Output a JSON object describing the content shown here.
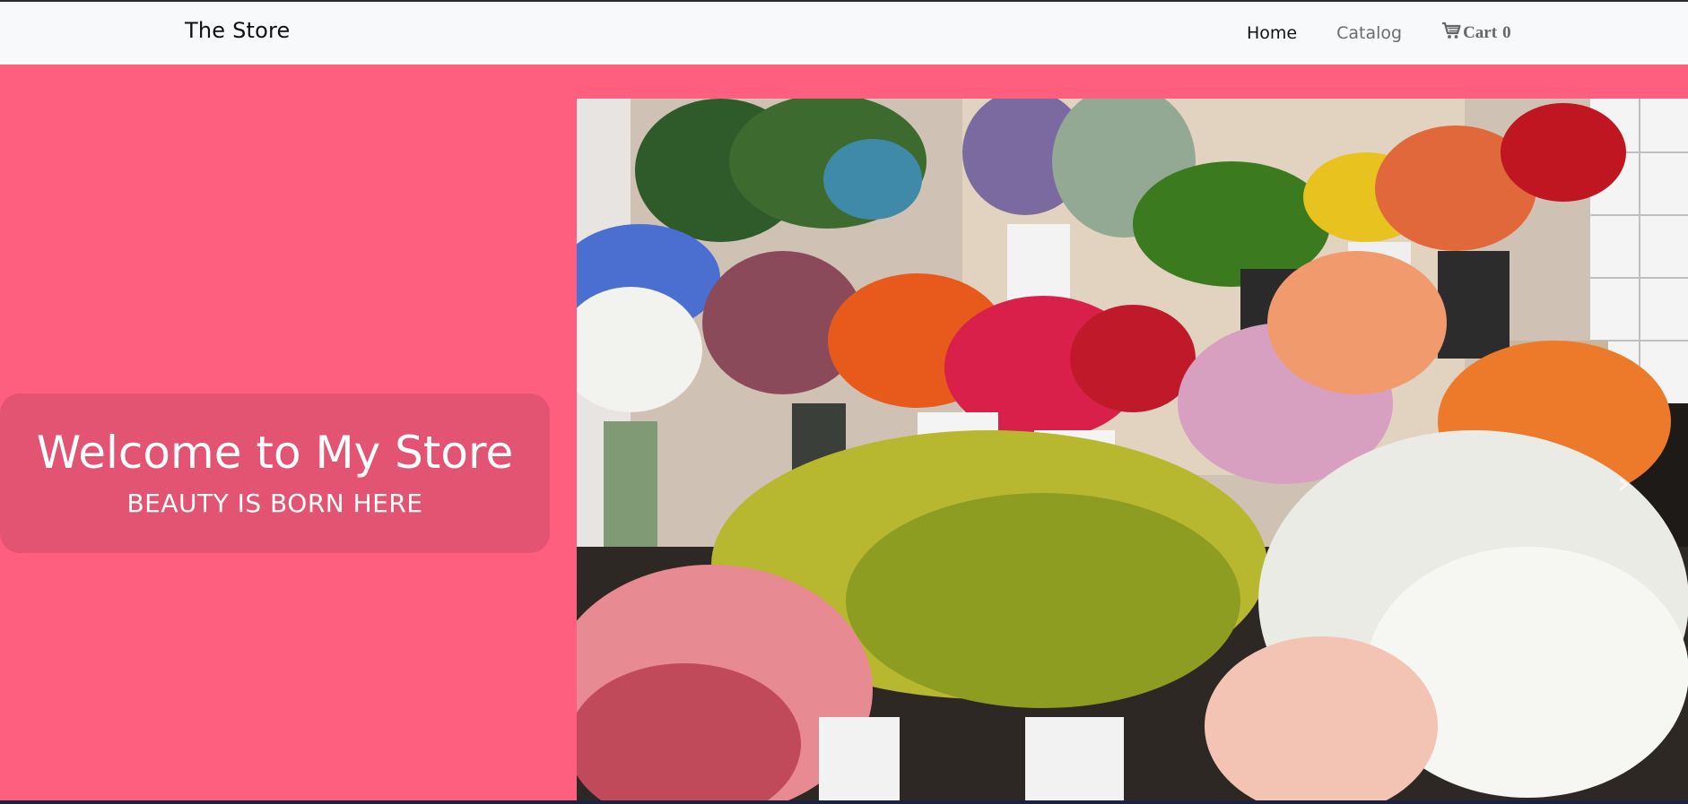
{
  "navbar": {
    "brand": "The Store",
    "links": [
      {
        "label": "Home",
        "active": true
      },
      {
        "label": "Catalog",
        "active": false
      }
    ],
    "cart": {
      "label": "Cart",
      "count": "0",
      "icon": "cart-icon"
    }
  },
  "hero": {
    "background_color": "#ff5f7e",
    "welcome_title": "Welcome to My Store",
    "welcome_subtitle": "BEAUTY IS BORN HERE",
    "image_subject": "flower shop bouquets in vases",
    "carousel_control_icon": "chevron-right-icon"
  }
}
